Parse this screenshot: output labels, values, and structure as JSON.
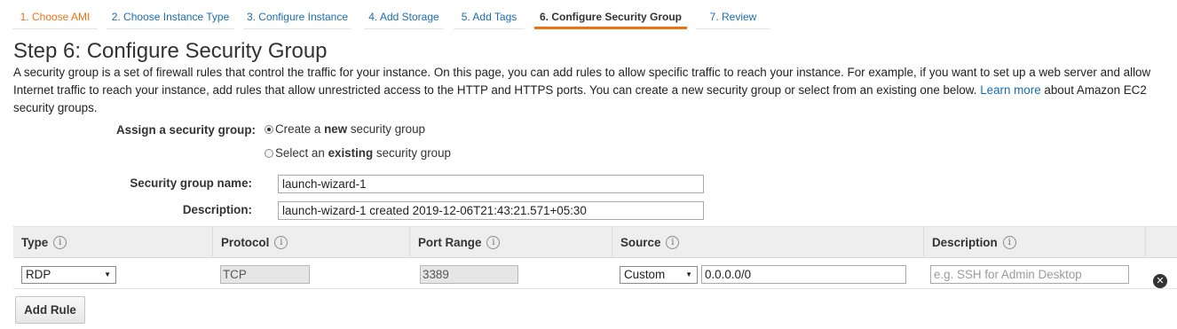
{
  "wizard": {
    "tabs": [
      {
        "label": "1. Choose AMI",
        "state": "done"
      },
      {
        "label": "2. Choose Instance Type",
        "state": "normal"
      },
      {
        "label": "3. Configure Instance",
        "state": "normal"
      },
      {
        "label": "4. Add Storage",
        "state": "normal"
      },
      {
        "label": "5. Add Tags",
        "state": "normal"
      },
      {
        "label": "6. Configure Security Group",
        "state": "active"
      },
      {
        "label": "7. Review",
        "state": "normal"
      }
    ]
  },
  "page": {
    "title": "Step 6: Configure Security Group",
    "intro_text": "A security group is a set of firewall rules that control the traffic for your instance. On this page, you can add rules to allow specific traffic to reach your instance. For example, if you want to set up a web server and allow Internet traffic to reach your instance, add rules that allow unrestricted access to the HTTP and HTTPS ports. You can create a new security group or select from an existing one below.",
    "learn_more": "Learn more",
    "intro_tail": "about Amazon EC2 security groups."
  },
  "form": {
    "assign_label": "Assign a security group:",
    "option_create": {
      "pre": "Create a ",
      "bold": "new",
      "post": " security group",
      "selected": true
    },
    "option_existing": {
      "pre": "Select an ",
      "bold": "existing",
      "post": " security group",
      "selected": false
    },
    "name_label": "Security group name:",
    "name_value": "launch-wizard-1",
    "description_label": "Description:",
    "description_value": "launch-wizard-1 created 2019-12-06T21:43:21.571+05:30"
  },
  "rules_table": {
    "headers": {
      "type": "Type",
      "protocol": "Protocol",
      "port_range": "Port Range",
      "source": "Source",
      "description": "Description"
    },
    "info_glyph": "i",
    "rows": [
      {
        "type": "RDP",
        "protocol": "TCP",
        "port_range": "3389",
        "source_mode": "Custom",
        "source_cidr": "0.0.0.0/0",
        "description_placeholder": "e.g. SSH for Admin Desktop"
      }
    ]
  },
  "actions": {
    "add_rule": "Add Rule",
    "remove_glyph": "✕"
  },
  "colors": {
    "accent_orange": "#ec7211",
    "link_blue": "#1a6db5"
  }
}
